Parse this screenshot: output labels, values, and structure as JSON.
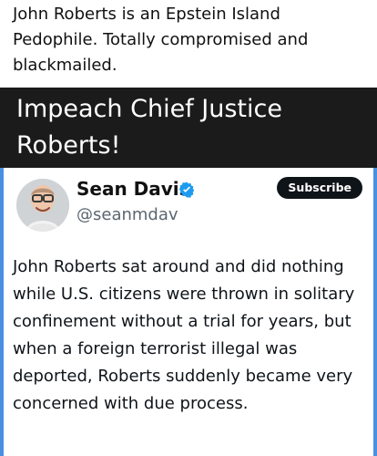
{
  "caption": {
    "text": "John Roberts is an Epstein Island Pedophile. Totally compromised and blackmailed."
  },
  "banner": {
    "text": "Impeach Chief Justice Roberts!"
  },
  "tweet": {
    "author_name": "Sean Davis",
    "author_handle": "@seanmdav",
    "subscribe_label": "Subscribe",
    "body": "John Roberts sat around and did nothing while U.S. citizens were thrown in solitary confinement without a trial for years, but when a foreign terrorist illegal was deported, Roberts suddenly became very concerned with due process.",
    "verified_badge_color": "#1d9bf0",
    "accent_border_color": "#4a90e2"
  },
  "icons": {
    "verified": "verified-badge-icon",
    "avatar": "profile-avatar"
  }
}
